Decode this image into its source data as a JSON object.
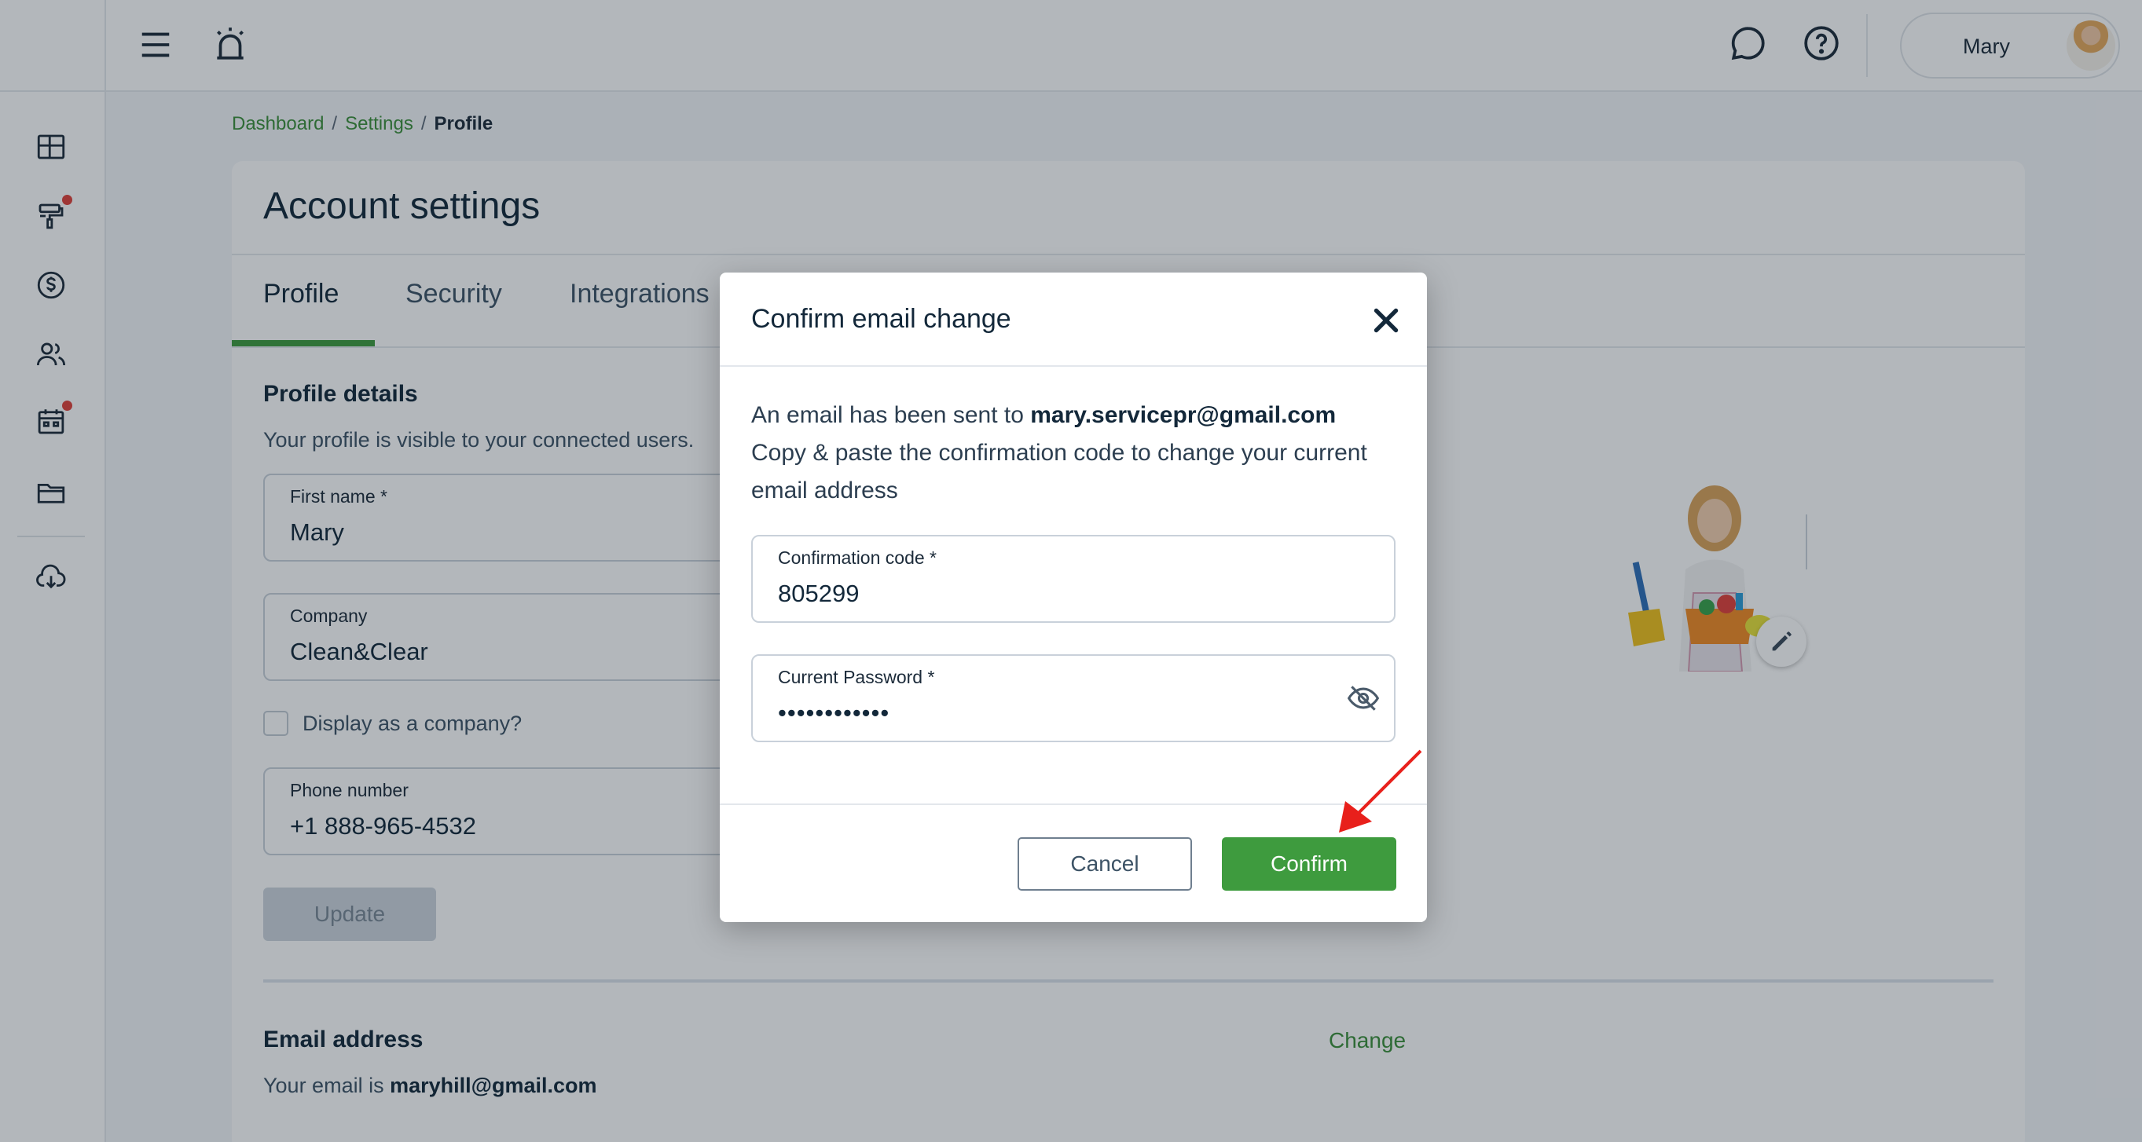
{
  "topbar": {
    "user_name": "Mary"
  },
  "breadcrumb": {
    "items": [
      "Dashboard",
      "Settings"
    ],
    "current": "Profile",
    "separator": "/"
  },
  "page": {
    "title": "Account settings",
    "tabs": [
      {
        "label": "Profile",
        "active": true
      },
      {
        "label": "Security",
        "active": false
      },
      {
        "label": "Integrations",
        "active": false
      }
    ]
  },
  "profile": {
    "section_title": "Profile details",
    "section_desc": "Your profile is visible to your connected users.",
    "first_name": {
      "label": "First name *",
      "value": "Mary"
    },
    "company": {
      "label": "Company",
      "value": "Clean&Clear"
    },
    "display_as_company": {
      "label": "Display as a company?",
      "checked": false
    },
    "phone": {
      "label": "Phone number",
      "value": "+1 888-965-4532"
    },
    "update_label": "Update"
  },
  "email_section": {
    "title": "Email address",
    "desc_prefix": "Your email is",
    "email": "maryhill@gmail.com",
    "change_label": "Change"
  },
  "modal": {
    "title": "Confirm email change",
    "text_prefix": "An email has been sent to",
    "sent_email": "mary.servicepr@gmail.com",
    "text_body": "Copy & paste the confirmation code to change your current email address",
    "code": {
      "label": "Confirmation code *",
      "value": "805299"
    },
    "password": {
      "label": "Current Password *",
      "value": "••••••••••••"
    },
    "cancel_label": "Cancel",
    "confirm_label": "Confirm"
  },
  "colors": {
    "accent_green": "#3e9b3e",
    "link_green": "#3b8f3a",
    "notification_red": "#e0413a",
    "annotation_red": "#e8201b"
  },
  "icons": {
    "rail": [
      "dashboard-icon",
      "paint-roller-icon",
      "dollar-icon",
      "users-icon",
      "calendar-icon",
      "folder-icon",
      "cloud-download-icon"
    ],
    "topbar": [
      "menu-icon",
      "alarm-icon",
      "chat-icon",
      "help-icon"
    ]
  }
}
